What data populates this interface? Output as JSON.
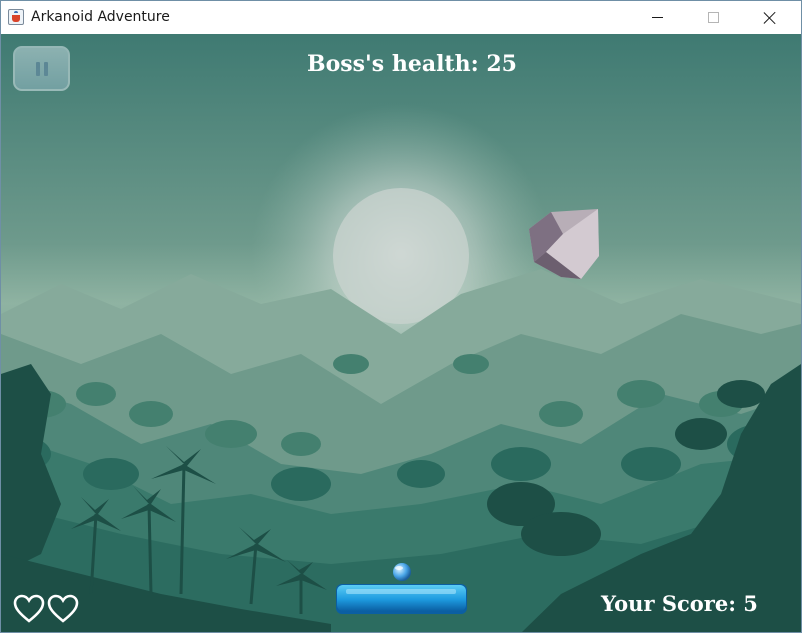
{
  "window": {
    "title": "Arkanoid Adventure",
    "icon": "java-cup-icon",
    "controls": [
      "minimize",
      "maximize",
      "close"
    ]
  },
  "hud": {
    "boss_health": "Boss's health: 25",
    "score": "Your Score: 5",
    "lives": 2,
    "pause_icon": "pause-icon"
  },
  "game": {
    "objects": [
      "boss-gem",
      "ball",
      "paddle"
    ],
    "background": "jungle-mountains-sunset"
  },
  "colors": {
    "sky": "#6e9a8c",
    "paddle": "#1e9be0",
    "ball": "#4aa6e8",
    "boss": "#b8aeb7",
    "hud_text": "#ffffff"
  }
}
